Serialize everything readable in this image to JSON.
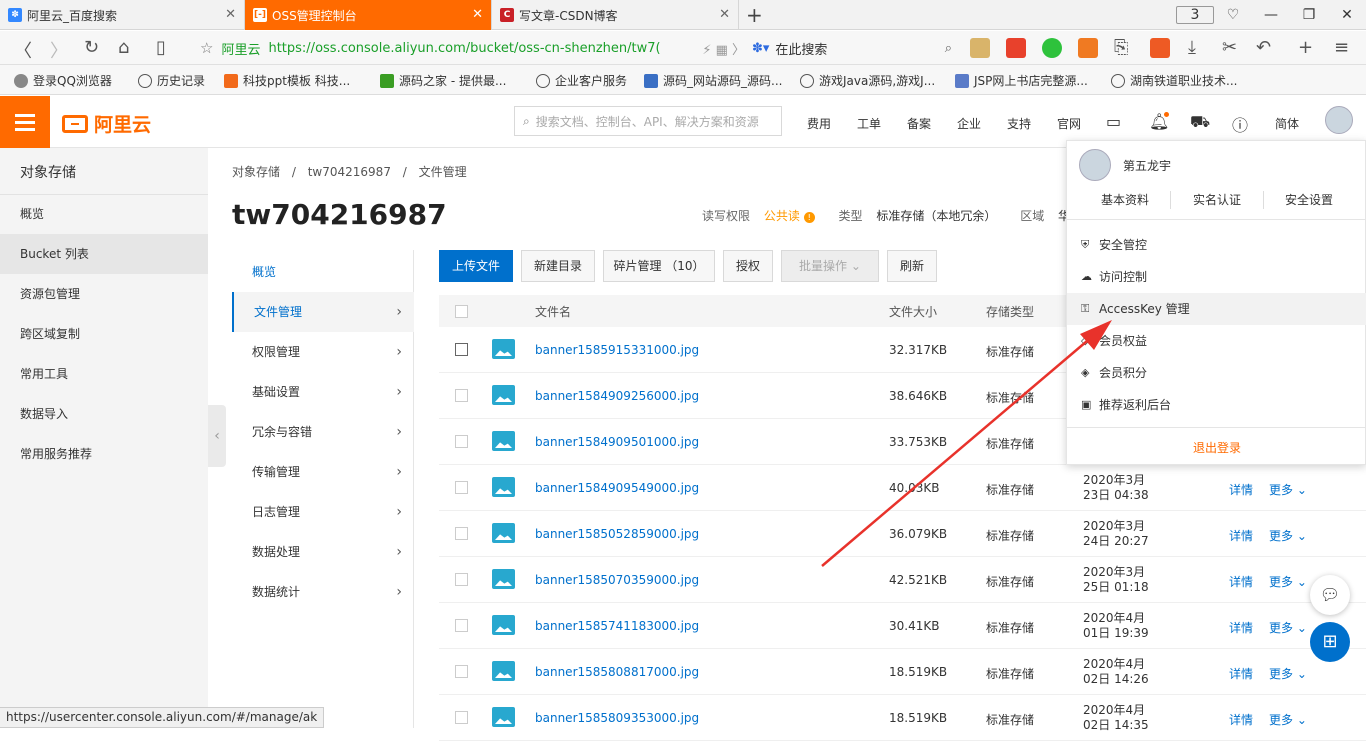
{
  "browser": {
    "tabs": [
      {
        "label": "阿里云_百度搜索",
        "active": false
      },
      {
        "label": "OSS管理控制台",
        "active": true
      },
      {
        "label": "写文章-CSDN博客",
        "active": false
      }
    ],
    "tab_count": "3",
    "url_site": "阿里云",
    "url": "https://oss.console.aliyun.com/bucket/oss-cn-shenzhen/tw7(",
    "search_placeholder": "在此搜索",
    "bookmarks": [
      "登录QQ浏览器",
      "历史记录",
      "科技ppt模板 科技...",
      "源码之家 - 提供最...",
      "企业客户服务",
      "源码_网站源码_源码...",
      "游戏Java源码,游戏J...",
      "JSP网上书店完整源...",
      "湖南铁道职业技术..."
    ]
  },
  "header": {
    "logo": "阿里云",
    "search_placeholder": "搜索文档、控制台、API、解决方案和资源",
    "nav": [
      "费用",
      "工单",
      "备案",
      "企业",
      "支持",
      "官网"
    ],
    "lang": "简体"
  },
  "sidebar": {
    "title": "对象存储",
    "items": [
      "概览",
      "Bucket 列表",
      "资源包管理",
      "跨区域复制",
      "常用工具",
      "数据导入",
      "常用服务推荐"
    ],
    "active_index": 1
  },
  "breadcrumb": [
    "对象存储",
    "/",
    "tw704216987",
    "/",
    "文件管理"
  ],
  "bucket": {
    "name": "tw704216987",
    "acl_label": "读写权限",
    "acl_value": "公共读",
    "type_label": "类型",
    "type_value": "标准存储（本地冗余）",
    "region_label": "区域",
    "region_value": "华南"
  },
  "subnav": [
    "概览",
    "文件管理",
    "权限管理",
    "基础设置",
    "冗余与容错",
    "传输管理",
    "日志管理",
    "数据处理",
    "数据统计"
  ],
  "toolbar": {
    "upload": "上传文件",
    "new_dir": "新建目录",
    "fragments": "碎片管理 （10）",
    "authorize": "授权",
    "batch": "批量操作",
    "refresh": "刷新"
  },
  "table": {
    "headers": {
      "name": "文件名",
      "size": "文件大小",
      "storage": "存储类型"
    },
    "rows": [
      {
        "name": "banner1585915331000.jpg",
        "size": "32.317KB",
        "storage": "标准存储",
        "date1": "",
        "date2": "",
        "detail": "",
        "more": ""
      },
      {
        "name": "banner1584909256000.jpg",
        "size": "38.646KB",
        "storage": "标准存储",
        "date1": "",
        "date2": "",
        "detail": "",
        "more": ""
      },
      {
        "name": "banner1584909501000.jpg",
        "size": "33.753KB",
        "storage": "标准存储",
        "date1": "",
        "date2": "",
        "detail": "",
        "more": ""
      },
      {
        "name": "banner1584909549000.jpg",
        "size": "40.03KB",
        "storage": "标准存储",
        "date1": "2020年3月",
        "date2": "23日 04:38",
        "detail": "详情",
        "more": "更多"
      },
      {
        "name": "banner1585052859000.jpg",
        "size": "36.079KB",
        "storage": "标准存储",
        "date1": "2020年3月",
        "date2": "24日 20:27",
        "detail": "详情",
        "more": "更多"
      },
      {
        "name": "banner1585070359000.jpg",
        "size": "42.521KB",
        "storage": "标准存储",
        "date1": "2020年3月",
        "date2": "25日 01:18",
        "detail": "详情",
        "more": "更多"
      },
      {
        "name": "banner1585741183000.jpg",
        "size": "30.41KB",
        "storage": "标准存储",
        "date1": "2020年4月",
        "date2": "01日 19:39",
        "detail": "详情",
        "more": "更多"
      },
      {
        "name": "banner1585808817000.jpg",
        "size": "18.519KB",
        "storage": "标准存储",
        "date1": "2020年4月",
        "date2": "02日 14:26",
        "detail": "详情",
        "more": "更多"
      },
      {
        "name": "banner1585809353000.jpg",
        "size": "18.519KB",
        "storage": "标准存储",
        "date1": "2020年4月",
        "date2": "02日 14:35",
        "detail": "详情",
        "more": "更多"
      }
    ]
  },
  "user_menu": {
    "username": "第五龙宇",
    "links": [
      "基本资料",
      "实名认证",
      "安全设置"
    ],
    "items": [
      "安全管控",
      "访问控制",
      "AccessKey 管理",
      "会员权益",
      "会员积分",
      "推荐返利后台"
    ],
    "hover_index": 2,
    "logout": "退出登录"
  },
  "status_url": "https://usercenter.console.aliyun.com/#/manage/ak",
  "colors": {
    "brand": "#ff6a00",
    "link": "#0070cc",
    "arrow": "#e8322b"
  }
}
